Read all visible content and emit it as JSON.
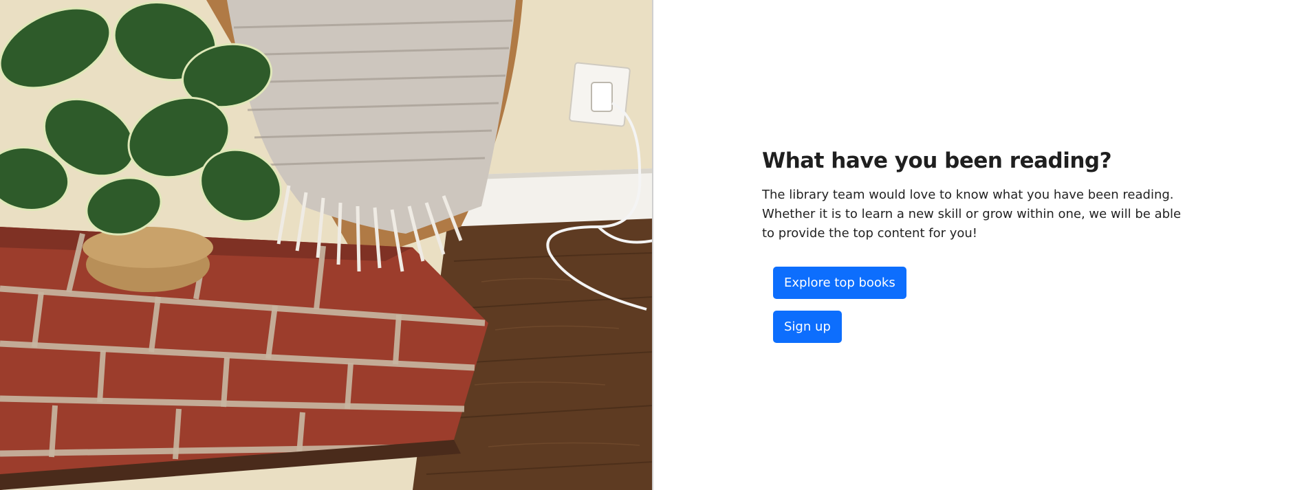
{
  "hero": {
    "image_alt": "Potted plant and woven throw on a red brick hearth beside a wall outlet",
    "colors": {
      "wall": "#e9dcbf",
      "floor": "#5b3a22",
      "brick": "#9b3b2a",
      "throw": "#cfc9c2",
      "leaf": "#2f5a2a"
    }
  },
  "content": {
    "headline": "What have you been reading?",
    "lead": "The library team would love to know what you have been reading. Whether it is to learn a new skill or grow within one, we will be able to provide the top content for you!",
    "primary_button": "Explore top books",
    "secondary_button": "Sign up"
  },
  "colors": {
    "button_bg": "#0d6efd",
    "button_text": "#ffffff",
    "text": "#1f1f1f"
  }
}
